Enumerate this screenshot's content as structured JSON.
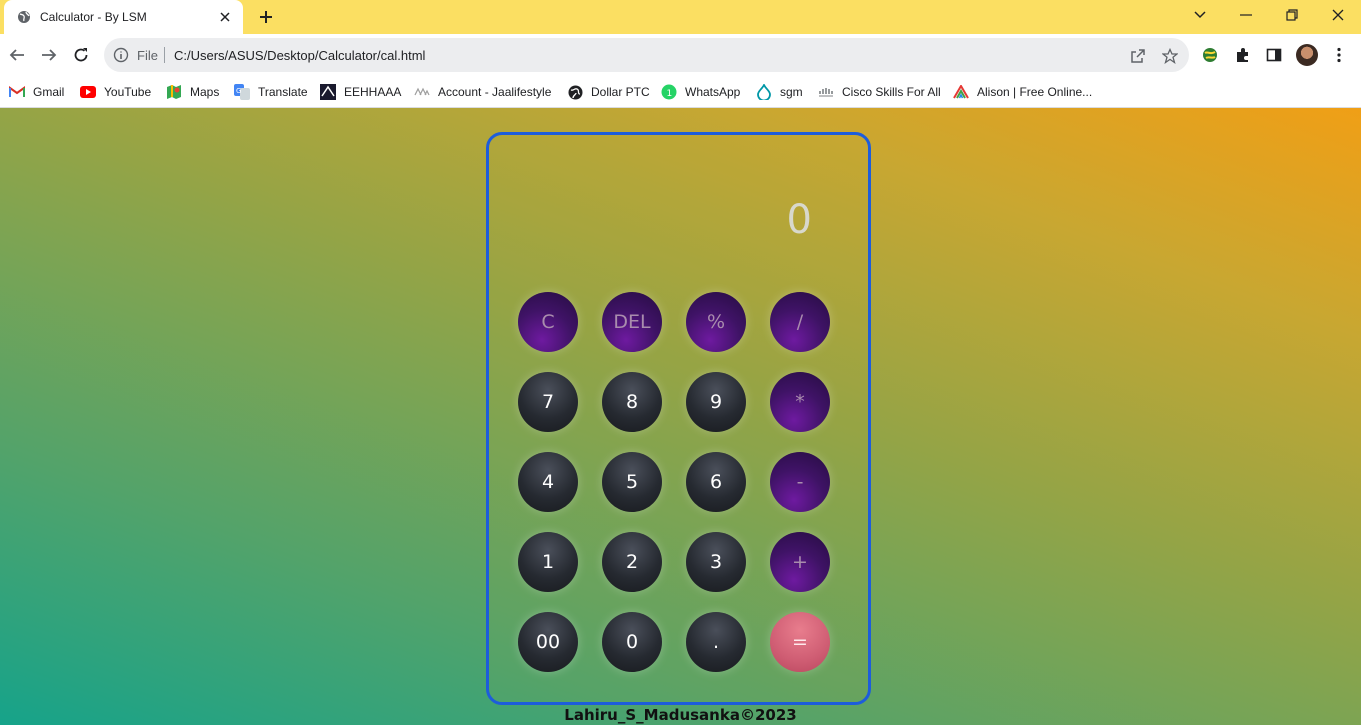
{
  "browser": {
    "tab": {
      "title": "Calculator - By LSM"
    },
    "omnibox": {
      "scheme": "File",
      "url": "C:/Users/ASUS/Desktop/Calculator/cal.html"
    },
    "bookmarks": [
      {
        "label": "Gmail",
        "icon": "gmail-icon"
      },
      {
        "label": "YouTube",
        "icon": "youtube-icon"
      },
      {
        "label": "Maps",
        "icon": "maps-icon"
      },
      {
        "label": "Translate",
        "icon": "translate-icon"
      },
      {
        "label": "EEHHAAA",
        "icon": "eehhaaa-icon"
      },
      {
        "label": "Account - Jaalifestyle",
        "icon": "jaalifestyle-icon"
      },
      {
        "label": "Dollar PTC",
        "icon": "globe-icon"
      },
      {
        "label": "WhatsApp",
        "icon": "whatsapp-icon"
      },
      {
        "label": "sgm",
        "icon": "drop-icon"
      },
      {
        "label": "Cisco Skills For All",
        "icon": "cisco-icon"
      },
      {
        "label": "Alison | Free Online...",
        "icon": "alison-icon"
      }
    ]
  },
  "calculator": {
    "display": "0",
    "rows": [
      [
        {
          "label": "C",
          "type": "op"
        },
        {
          "label": "DEL",
          "type": "op"
        },
        {
          "label": "%",
          "type": "op"
        },
        {
          "label": "/",
          "type": "op"
        }
      ],
      [
        {
          "label": "7",
          "type": "num"
        },
        {
          "label": "8",
          "type": "num"
        },
        {
          "label": "9",
          "type": "num"
        },
        {
          "label": "*",
          "type": "op"
        }
      ],
      [
        {
          "label": "4",
          "type": "num"
        },
        {
          "label": "5",
          "type": "num"
        },
        {
          "label": "6",
          "type": "num"
        },
        {
          "label": "-",
          "type": "op"
        }
      ],
      [
        {
          "label": "1",
          "type": "num"
        },
        {
          "label": "2",
          "type": "num"
        },
        {
          "label": "3",
          "type": "num"
        },
        {
          "label": "+",
          "type": "op"
        }
      ],
      [
        {
          "label": "00",
          "type": "num"
        },
        {
          "label": "0",
          "type": "num"
        },
        {
          "label": ".",
          "type": "num"
        },
        {
          "label": "=",
          "type": "eq"
        }
      ]
    ],
    "footer": "Lahiru_S_Madusanka©2023"
  },
  "colors": {
    "tabstrip": "#fbdf62",
    "frame_border": "#1d5ddb",
    "operator_button": "#3f1366",
    "number_button": "#262a31",
    "equals_button": "#cf5d73"
  }
}
